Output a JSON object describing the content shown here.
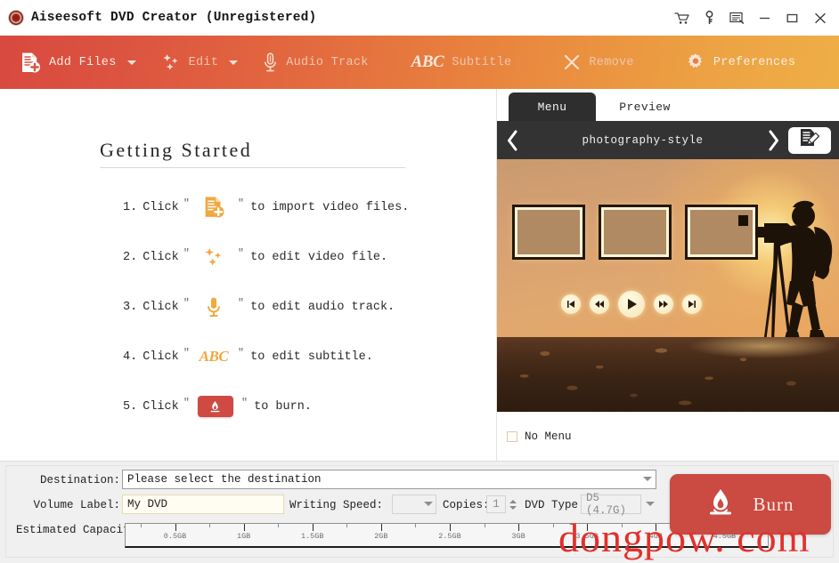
{
  "window": {
    "title": "Aiseesoft DVD Creator (Unregistered)",
    "app_icon": "disc-icon",
    "controls": [
      {
        "name": "cart-icon",
        "label": ""
      },
      {
        "name": "key-icon",
        "label": ""
      },
      {
        "name": "feedback-icon",
        "label": ""
      },
      {
        "name": "minimize-icon",
        "label": ""
      },
      {
        "name": "maximize-icon",
        "label": ""
      },
      {
        "name": "close-icon",
        "label": ""
      }
    ]
  },
  "toolbar": {
    "add_files": "Add Files",
    "edit": "Edit",
    "audio_track": "Audio Track",
    "subtitle": "Subtitle",
    "subtitle_icon_text": "ABC",
    "remove": "Remove",
    "preferences": "Preferences",
    "gradient_start": "#d8493f",
    "gradient_end": "#efae46"
  },
  "getting_started": {
    "title": "Getting Started",
    "quote_open": "″",
    "quote_close": "″",
    "steps": [
      {
        "num": "1.",
        "click": "Click",
        "icon": "add-files-icon",
        "tail": "to import video files."
      },
      {
        "num": "2.",
        "click": "Click",
        "icon": "edit-icon",
        "tail": "to edit video file."
      },
      {
        "num": "3.",
        "click": "Click",
        "icon": "microphone-icon",
        "tail": "to edit audio track."
      },
      {
        "num": "4.",
        "click": "Click",
        "icon": "abc-icon",
        "tail": "to edit subtitle."
      },
      {
        "num": "5.",
        "click": "Click",
        "icon": "burn-chip-icon",
        "tail": "to burn."
      }
    ]
  },
  "right_panel": {
    "tabs": [
      {
        "label": "Menu",
        "active": true
      },
      {
        "label": "Preview",
        "active": false
      }
    ],
    "menu_style": "photography-style",
    "prev_arrow": "‹",
    "next_arrow": "›",
    "edit_menu_icon": "edit-document-icon",
    "no_menu_label": "No Menu",
    "no_menu_checked": false,
    "preview_controls": [
      "prev-track",
      "rewind",
      "play",
      "forward",
      "next-track"
    ]
  },
  "bottom": {
    "destination_label": "Destination:",
    "destination_value": "Please select the destination",
    "volume_label_label": "Volume Label:",
    "volume_label_value": "My DVD",
    "writing_speed_label": "Writing Speed:",
    "writing_speed_value": "",
    "copies_label": "Copies:",
    "copies_value": "1",
    "dvd_type_label": "DVD Type:",
    "dvd_type_value": "D5 (4.7G)",
    "estimated_capacity_label": "Estimated Capacity:",
    "burn_label": "Burn",
    "burn_icon": "flame-icon",
    "burn_color": "#cb4a42"
  },
  "capacity_ruler": {
    "ticks": [
      "0.5GB",
      "1GB",
      "1.5GB",
      "2GB",
      "2.5GB",
      "3GB",
      "3.5GB",
      "4GB",
      "4.5GB"
    ],
    "max_label": "4.5GB"
  },
  "watermark": {
    "text": "dongpow. com",
    "color": "#e3302c"
  }
}
